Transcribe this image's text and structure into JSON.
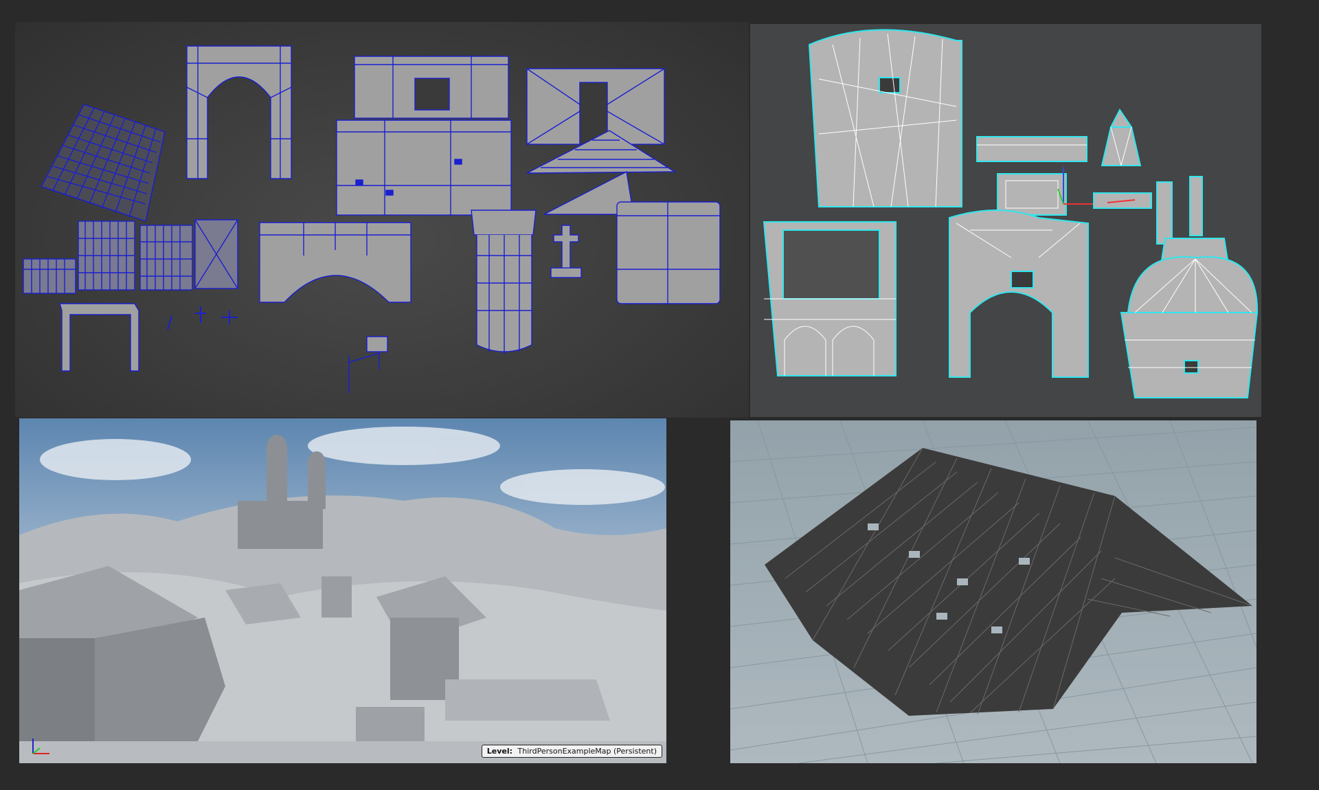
{
  "panels": {
    "wireframe_kit": {
      "name": "modular-kit-wireframe-viewport",
      "wire_color": "#1a1fd0",
      "fill_color": "#9e9e9e"
    },
    "church_parts": {
      "name": "church-parts-viewport",
      "wire_color": "#ffffff",
      "outline_color": "#2ee6ee",
      "fill_color": "#b4b4b4"
    },
    "unreal_level": {
      "name": "level-preview-viewport",
      "level_key": "Level:",
      "level_value": "ThirdPersonExampleMap (Persistent)"
    },
    "roof_tiles": {
      "name": "roof-tiles-grid-viewport",
      "grid_color": "#8797a0",
      "mesh_color": "#3b3b3b"
    }
  }
}
